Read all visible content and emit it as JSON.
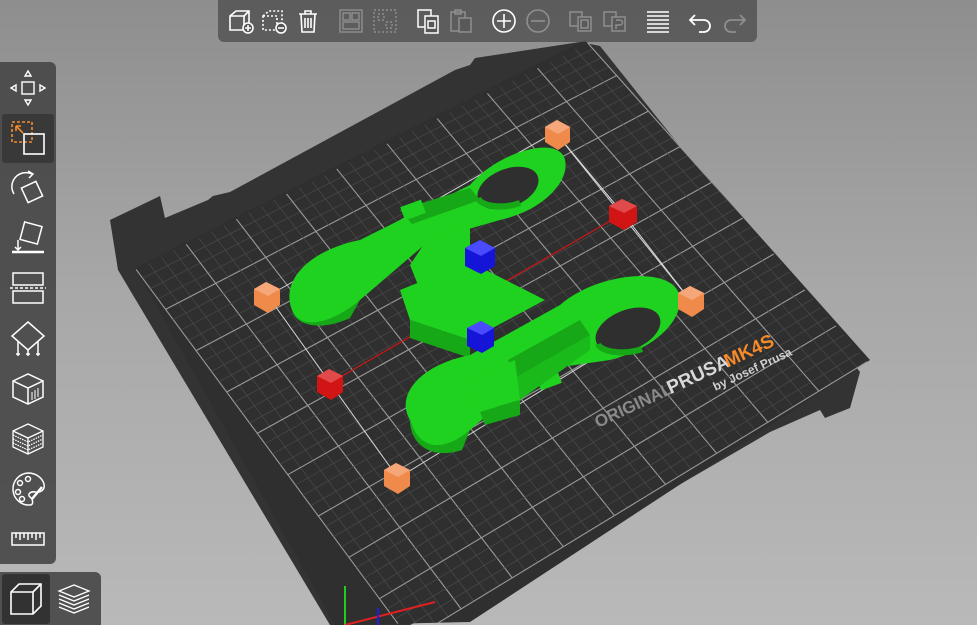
{
  "bed": {
    "brand_original": "ORIGINAL",
    "brand_prusa": "PRUSA",
    "brand_model": "MK4S",
    "brand_byline": "by Josef Prusa"
  },
  "colors": {
    "model_green": "#1fd21f",
    "model_green_dark": "#16a816",
    "scale_handle": "#f08a4b",
    "x_handle": "#d11414",
    "z_handle": "#1515d8",
    "accent_orange": "#f58a2a",
    "bed_grid": "#3c3c3c",
    "bed_frame": "#333333"
  },
  "top_toolbar": [
    {
      "icon": "add-object-icon",
      "state": "enabled"
    },
    {
      "icon": "delete-object-icon",
      "state": "enabled"
    },
    {
      "icon": "delete-all-icon",
      "state": "enabled"
    },
    {
      "icon": "arrange-icon",
      "state": "disabled"
    },
    {
      "icon": "arrange-selection-icon",
      "state": "disabled"
    },
    {
      "icon": "copy-icon",
      "state": "enabled"
    },
    {
      "icon": "paste-icon",
      "state": "disabled"
    },
    {
      "icon": "add-instance-icon",
      "state": "enabled"
    },
    {
      "icon": "remove-instance-icon",
      "state": "disabled"
    },
    {
      "icon": "split-objects-icon",
      "state": "disabled"
    },
    {
      "icon": "split-parts-icon",
      "state": "disabled"
    },
    {
      "icon": "layer-editing-icon",
      "state": "enabled"
    },
    {
      "icon": "undo-icon",
      "state": "enabled"
    },
    {
      "icon": "redo-icon",
      "state": "disabled"
    }
  ],
  "left_toolbar": [
    {
      "icon": "move-icon",
      "active": false
    },
    {
      "icon": "scale-icon",
      "active": true
    },
    {
      "icon": "rotate-icon",
      "active": false
    },
    {
      "icon": "place-on-face-icon",
      "active": false
    },
    {
      "icon": "cut-icon",
      "active": false
    },
    {
      "icon": "paint-supports-icon",
      "active": false
    },
    {
      "icon": "seam-painting-icon",
      "active": false
    },
    {
      "icon": "fuzzy-skin-icon",
      "active": false
    },
    {
      "icon": "color-painting-icon",
      "active": false
    },
    {
      "icon": "measure-icon",
      "active": false
    }
  ],
  "view_toolbar": [
    {
      "icon": "3d-view-icon",
      "active": true
    },
    {
      "icon": "preview-icon",
      "active": false
    }
  ]
}
